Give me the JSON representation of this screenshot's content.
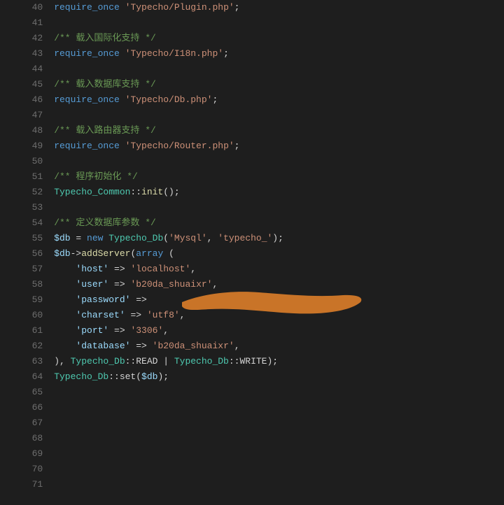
{
  "lines": [
    {
      "num": 40,
      "tokens": [
        {
          "t": "require_once",
          "c": "kw-require"
        },
        {
          "t": " ",
          "c": "plain"
        },
        {
          "t": "'Typecho/Plugin.php'",
          "c": "str"
        },
        {
          "t": ";",
          "c": "plain"
        }
      ]
    },
    {
      "num": 41,
      "tokens": []
    },
    {
      "num": 42,
      "tokens": [
        {
          "t": "/** 载入国际化支持 */",
          "c": "comment"
        }
      ]
    },
    {
      "num": 43,
      "tokens": [
        {
          "t": "require_once",
          "c": "kw-require"
        },
        {
          "t": " ",
          "c": "plain"
        },
        {
          "t": "'Typecho/I18n.php'",
          "c": "str"
        },
        {
          "t": ";",
          "c": "plain"
        }
      ]
    },
    {
      "num": 44,
      "tokens": []
    },
    {
      "num": 45,
      "tokens": [
        {
          "t": "/** 载入数据库支持 */",
          "c": "comment"
        }
      ]
    },
    {
      "num": 46,
      "tokens": [
        {
          "t": "require_once",
          "c": "kw-require"
        },
        {
          "t": " ",
          "c": "plain"
        },
        {
          "t": "'Typecho/Db.php'",
          "c": "str"
        },
        {
          "t": ";",
          "c": "plain"
        }
      ]
    },
    {
      "num": 47,
      "tokens": []
    },
    {
      "num": 48,
      "tokens": [
        {
          "t": "/** 载入路由器支持 */",
          "c": "comment"
        }
      ]
    },
    {
      "num": 49,
      "tokens": [
        {
          "t": "require_once",
          "c": "kw-require"
        },
        {
          "t": " ",
          "c": "plain"
        },
        {
          "t": "'Typecho/Router.php'",
          "c": "str"
        },
        {
          "t": ";",
          "c": "plain"
        }
      ]
    },
    {
      "num": 50,
      "tokens": []
    },
    {
      "num": 51,
      "tokens": [
        {
          "t": "/** 程序初始化 */",
          "c": "comment"
        }
      ]
    },
    {
      "num": 52,
      "tokens": [
        {
          "t": "Typecho_Common",
          "c": "classname"
        },
        {
          "t": "::",
          "c": "plain"
        },
        {
          "t": "init",
          "c": "func"
        },
        {
          "t": "();",
          "c": "plain"
        }
      ]
    },
    {
      "num": 53,
      "tokens": []
    },
    {
      "num": 54,
      "tokens": [
        {
          "t": "/** 定义数据库参数 */",
          "c": "comment"
        }
      ]
    },
    {
      "num": 55,
      "tokens": [
        {
          "t": "$db",
          "c": "var"
        },
        {
          "t": " = ",
          "c": "plain"
        },
        {
          "t": "new",
          "c": "kw-new"
        },
        {
          "t": " ",
          "c": "plain"
        },
        {
          "t": "Typecho_Db",
          "c": "classname"
        },
        {
          "t": "(",
          "c": "plain"
        },
        {
          "t": "'Mysql'",
          "c": "str"
        },
        {
          "t": ", ",
          "c": "plain"
        },
        {
          "t": "'typecho_'",
          "c": "str"
        },
        {
          "t": ");",
          "c": "plain"
        }
      ]
    },
    {
      "num": 56,
      "tokens": [
        {
          "t": "$db",
          "c": "var"
        },
        {
          "t": "->",
          "c": "plain"
        },
        {
          "t": "addServer",
          "c": "func"
        },
        {
          "t": "(",
          "c": "plain"
        },
        {
          "t": "array",
          "c": "kw-require"
        },
        {
          "t": " (",
          "c": "plain"
        }
      ]
    },
    {
      "num": 57,
      "tokens": [
        {
          "t": "    ",
          "c": "plain"
        },
        {
          "t": "'host'",
          "c": "key"
        },
        {
          "t": " => ",
          "c": "plain"
        },
        {
          "t": "'localhost'",
          "c": "str"
        },
        {
          "t": ",",
          "c": "plain"
        }
      ]
    },
    {
      "num": 58,
      "tokens": [
        {
          "t": "    ",
          "c": "plain"
        },
        {
          "t": "'user'",
          "c": "key"
        },
        {
          "t": " => ",
          "c": "plain"
        },
        {
          "t": "'b20da_shuaixr'",
          "c": "str"
        },
        {
          "t": ",",
          "c": "plain"
        }
      ]
    },
    {
      "num": 59,
      "tokens": [
        {
          "t": "    ",
          "c": "plain"
        },
        {
          "t": "'password'",
          "c": "key"
        },
        {
          "t": " =>",
          "c": "plain"
        }
      ]
    },
    {
      "num": 60,
      "tokens": [
        {
          "t": "    ",
          "c": "plain"
        },
        {
          "t": "'charset'",
          "c": "key"
        },
        {
          "t": " => ",
          "c": "plain"
        },
        {
          "t": "'utf8'",
          "c": "str"
        },
        {
          "t": ",",
          "c": "plain"
        }
      ]
    },
    {
      "num": 61,
      "tokens": [
        {
          "t": "    ",
          "c": "plain"
        },
        {
          "t": "'port'",
          "c": "key"
        },
        {
          "t": " => ",
          "c": "plain"
        },
        {
          "t": "'3306'",
          "c": "str"
        },
        {
          "t": ",",
          "c": "plain"
        }
      ]
    },
    {
      "num": 62,
      "tokens": [
        {
          "t": "    ",
          "c": "plain"
        },
        {
          "t": "'database'",
          "c": "key"
        },
        {
          "t": " => ",
          "c": "plain"
        },
        {
          "t": "'b20da_shuaixr'",
          "c": "str"
        },
        {
          "t": ",",
          "c": "plain"
        }
      ]
    },
    {
      "num": 63,
      "tokens": [
        {
          "t": "), ",
          "c": "plain"
        },
        {
          "t": "Typecho_Db",
          "c": "classname"
        },
        {
          "t": "::READ | ",
          "c": "plain"
        },
        {
          "t": "Typecho_Db",
          "c": "classname"
        },
        {
          "t": "::WRITE);",
          "c": "plain"
        }
      ]
    },
    {
      "num": 64,
      "tokens": [
        {
          "t": "Typecho_Db",
          "c": "classname"
        },
        {
          "t": "::set(",
          "c": "plain"
        },
        {
          "t": "$db",
          "c": "var"
        },
        {
          "t": ");",
          "c": "plain"
        }
      ]
    },
    {
      "num": 65,
      "tokens": []
    },
    {
      "num": 66,
      "tokens": []
    },
    {
      "num": 67,
      "tokens": []
    },
    {
      "num": 68,
      "tokens": []
    },
    {
      "num": 69,
      "tokens": []
    },
    {
      "num": 70,
      "tokens": []
    },
    {
      "num": 71,
      "tokens": []
    }
  ]
}
